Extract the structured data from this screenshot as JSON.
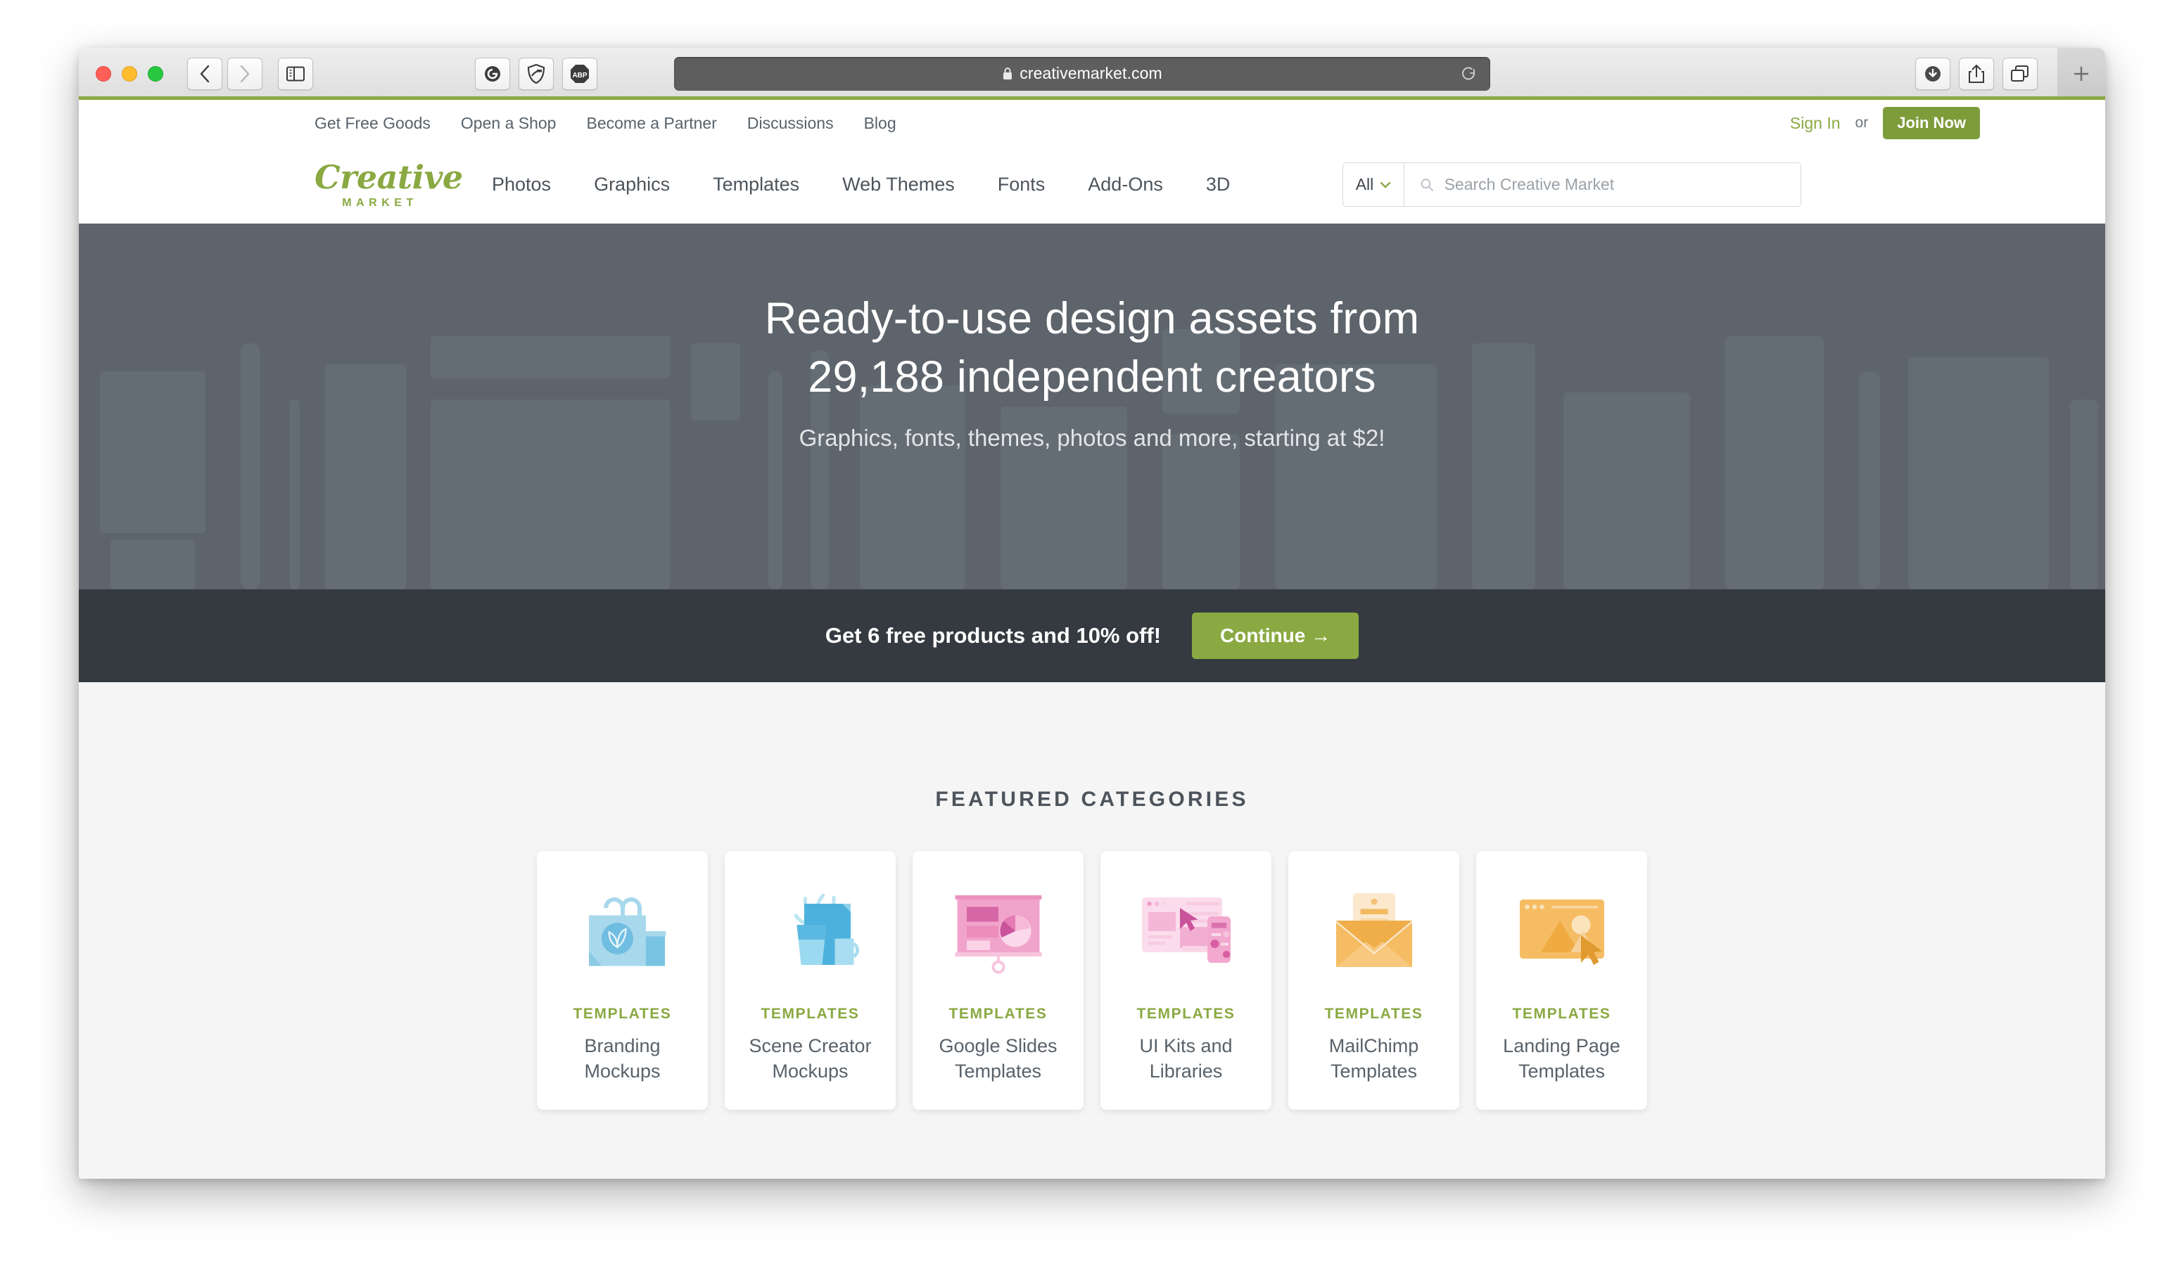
{
  "browser": {
    "url": "creativemarket.com",
    "lock_icon": "lock-icon",
    "back_icon": "chevron-left-icon",
    "forward_icon": "chevron-right-icon",
    "sidebar_icon": "sidebar-toggle-icon",
    "reload_icon": "reload-icon",
    "extensions": [
      {
        "name": "ghostery-extension-icon",
        "label": "G"
      },
      {
        "name": "shield-extension-icon",
        "label": ""
      },
      {
        "name": "adblock-plus-extension-icon",
        "label": "ABP"
      }
    ],
    "downloads_icon": "downloads-icon",
    "share_icon": "share-icon",
    "tab-overview_icon": "tab-overview-icon",
    "new_tab_label": "+"
  },
  "site": {
    "utility_nav": [
      {
        "label": "Get Free Goods"
      },
      {
        "label": "Open a Shop"
      },
      {
        "label": "Become a Partner"
      },
      {
        "label": "Discussions"
      },
      {
        "label": "Blog"
      }
    ],
    "account": {
      "sign_in": "Sign In",
      "or": "or",
      "join_now": "Join Now"
    },
    "logo": {
      "word": "Creative",
      "sub": "MARKET"
    },
    "main_nav": [
      {
        "label": "Photos"
      },
      {
        "label": "Graphics"
      },
      {
        "label": "Templates"
      },
      {
        "label": "Web Themes"
      },
      {
        "label": "Fonts"
      },
      {
        "label": "Add-Ons"
      },
      {
        "label": "3D"
      }
    ],
    "search": {
      "scope": "All",
      "chevron_icon": "chevron-down-icon",
      "search_icon": "search-icon",
      "placeholder": "Search Creative Market",
      "value": ""
    },
    "hero": {
      "title_line1": "Ready-to-use design assets from",
      "title_line2": "29,188 independent creators",
      "subtitle": "Graphics, fonts, themes, photos and more, starting at $2!",
      "creator_count": "29,188"
    },
    "promo": {
      "text": "Get 6 free products and 10% off!",
      "button": "Continue →"
    },
    "featured": {
      "heading": "FEATURED CATEGORIES",
      "cards": [
        {
          "kicker": "TEMPLATES",
          "title": "Branding Mockups",
          "icon": "shopping-bag-icon"
        },
        {
          "kicker": "TEMPLATES",
          "title": "Scene Creator Mockups",
          "icon": "plant-scene-icon"
        },
        {
          "kicker": "TEMPLATES",
          "title": "Google Slides Templates",
          "icon": "presentation-icon"
        },
        {
          "kicker": "TEMPLATES",
          "title": "UI Kits and Libraries",
          "icon": "ui-window-icon"
        },
        {
          "kicker": "TEMPLATES",
          "title": "MailChimp Templates",
          "icon": "envelope-icon"
        },
        {
          "kicker": "TEMPLATES",
          "title": "Landing Page Templates",
          "icon": "landing-page-icon"
        }
      ]
    }
  },
  "colors": {
    "brand_green": "#8aa942",
    "button_green": "#7f9c3b",
    "hero_bg": "#5d646b",
    "promo_bg": "#343a3f",
    "page_bg": "#f5f5f5",
    "text_gray": "#59626a"
  }
}
